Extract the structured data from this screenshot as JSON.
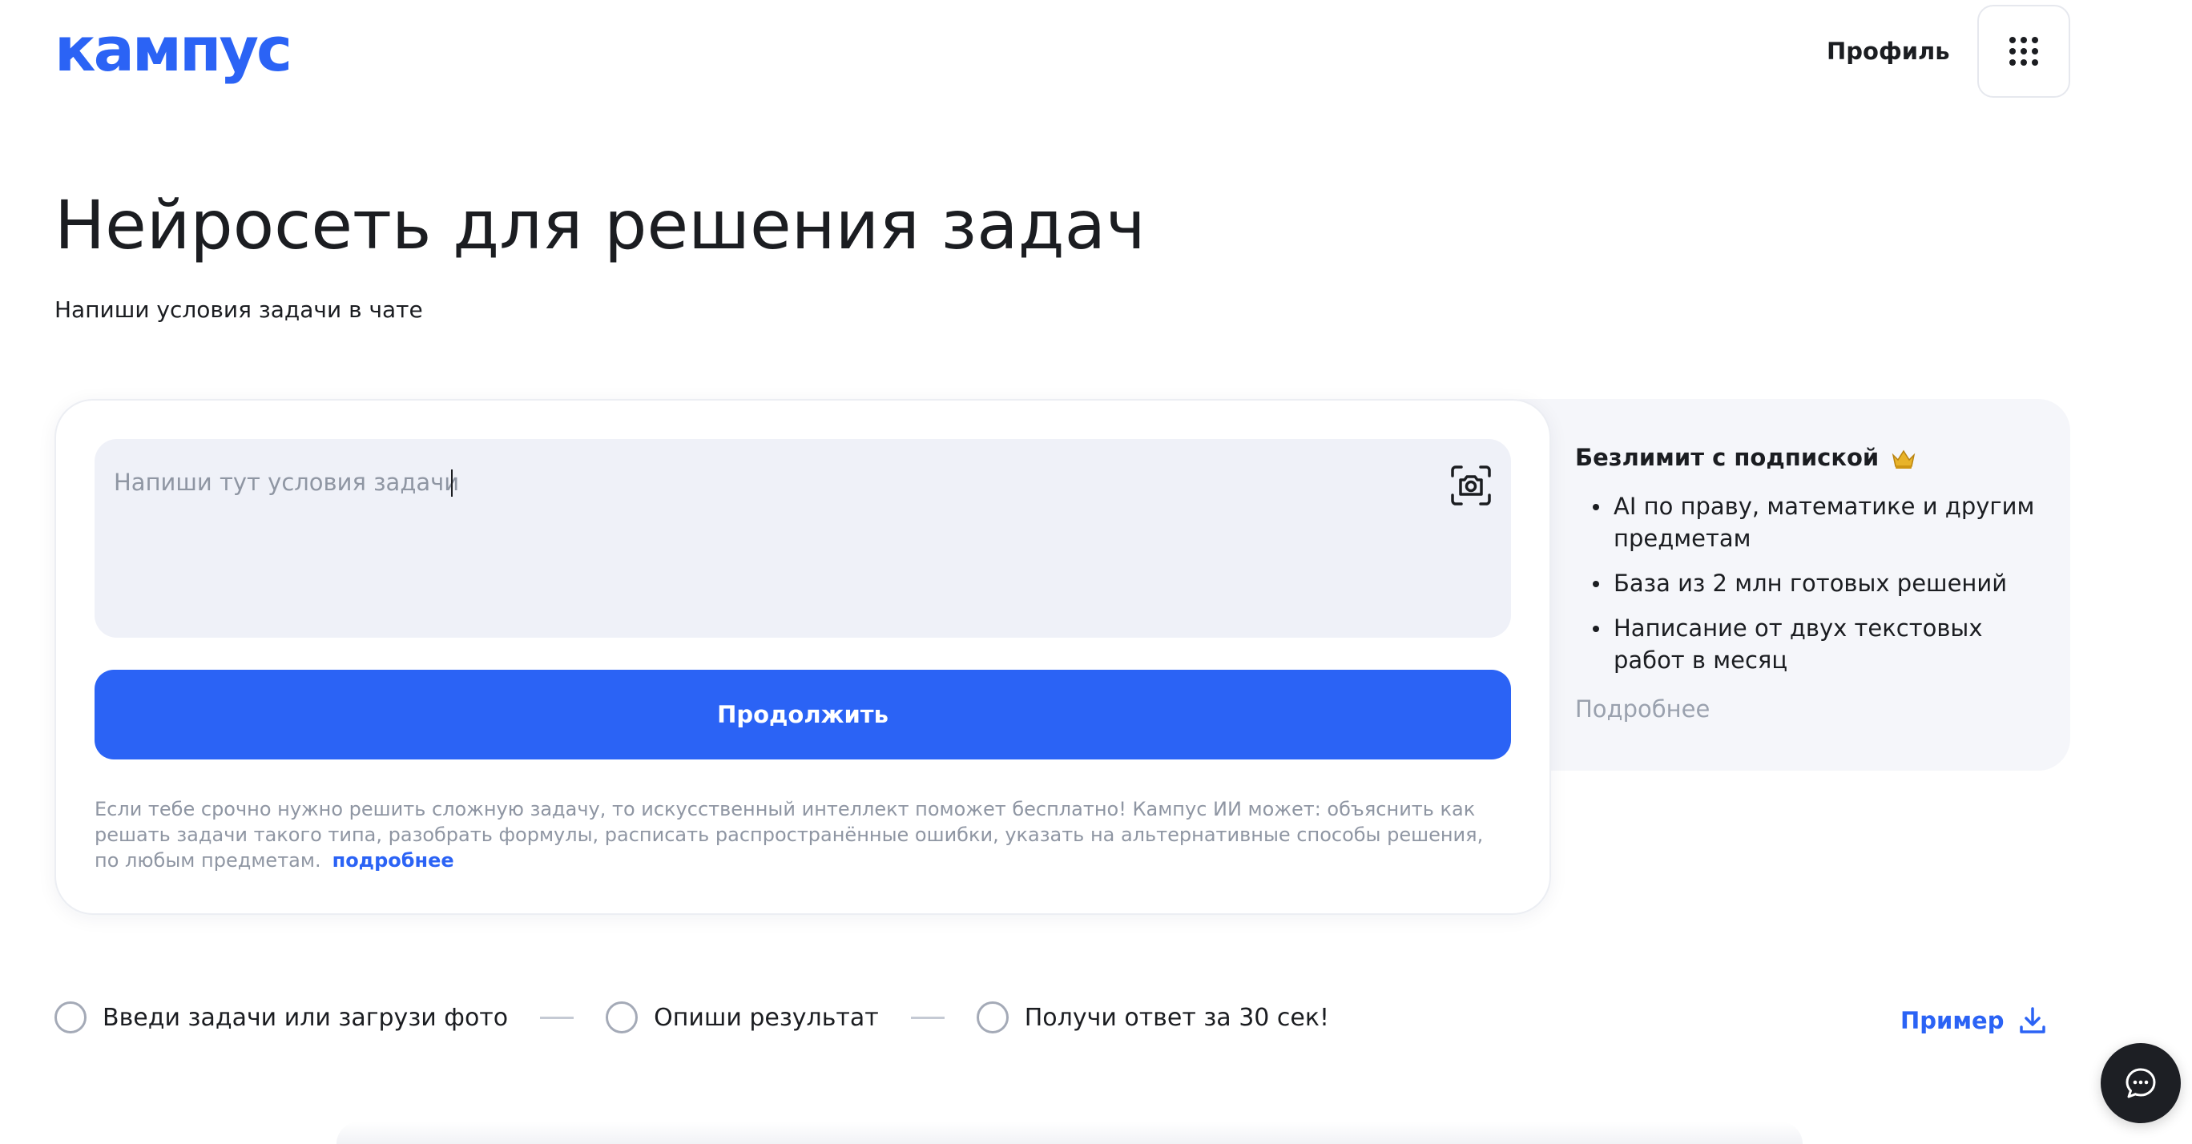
{
  "header": {
    "logo_text": "кампус",
    "profile_label": "Профиль",
    "apps_icon": "grid-dots-icon"
  },
  "hero": {
    "title": "Нейросеть для решения задач",
    "subtitle": "Напиши условия задачи в чате"
  },
  "task_form": {
    "placeholder": "Напиши тут условия задачи",
    "value": "",
    "photo_icon": "camera-scan-icon",
    "continue_label": "Продолжить",
    "disclaimer": "Если тебе срочно нужно решить сложную задачу, то искусственный интеллект поможет бесплатно! Кампус ИИ может: объяснить как решать задачи такого типа, разобрать формулы, расписать распространённые ошибки, указать на альтернативные способы решения, по любым предметам.",
    "disclaimer_link": "подробнее"
  },
  "promo": {
    "title": "Безлимит с подпиской",
    "title_icon": "crown-icon",
    "items": [
      "AI по праву, математике и другим предметам",
      "База из 2 млн готовых решений",
      "Написание от двух текстовых работ в месяц"
    ],
    "more_label": "Подробнее"
  },
  "steps": [
    "Введи задачи или загрузи фото",
    "Опиши результат",
    "Получи ответ за 30 сек!"
  ],
  "example": {
    "label": "Пример",
    "icon": "download-icon"
  },
  "chat": {
    "icon": "chat-bubble-icon"
  },
  "colors": {
    "brand": "#2b63f5",
    "text": "#1b1d21",
    "muted": "#8f96a3",
    "input_bg": "#eff1f8",
    "promo_bg": "#f5f6fa",
    "chat_bg": "#1d1f24"
  }
}
